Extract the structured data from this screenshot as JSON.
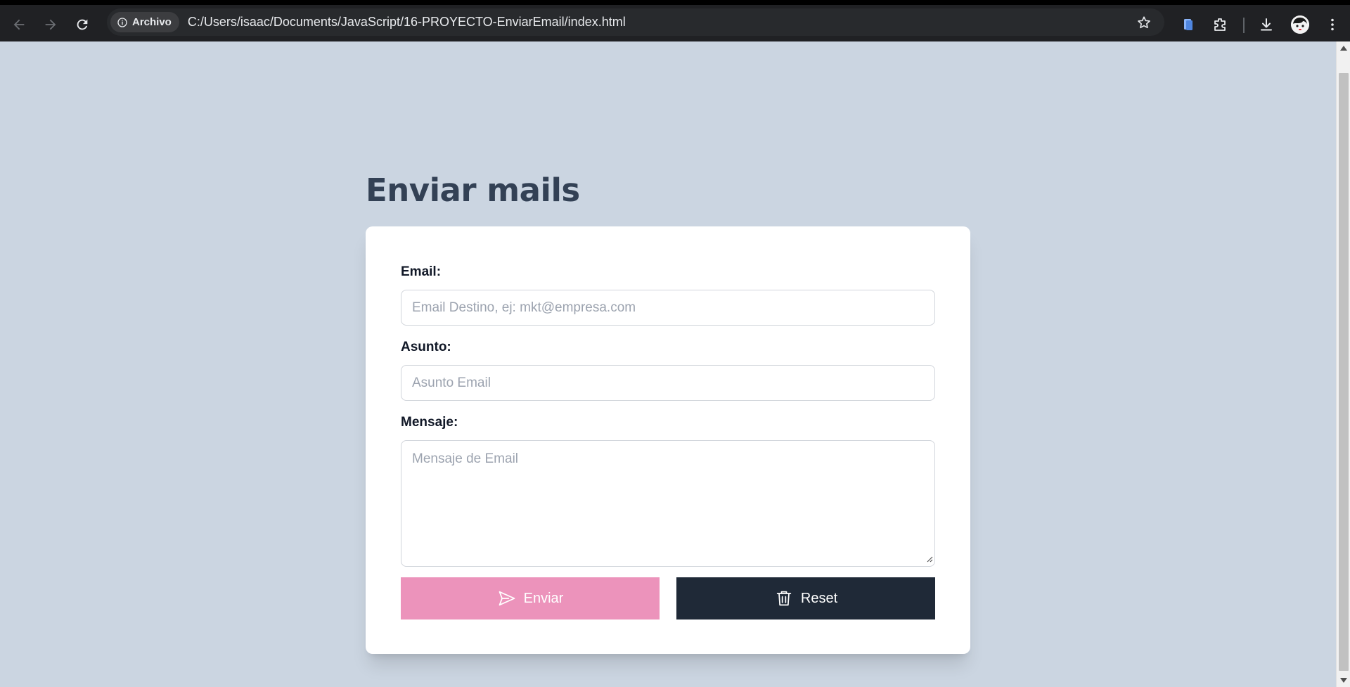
{
  "browser": {
    "chip_label": "Archivo",
    "url": "C:/Users/isaac/Documents/JavaScript/16-PROYECTO-EnviarEmail/index.html"
  },
  "page": {
    "title": "Enviar mails"
  },
  "form": {
    "email": {
      "label": "Email:",
      "placeholder": "Email Destino, ej: mkt@empresa.com",
      "value": ""
    },
    "asunto": {
      "label": "Asunto:",
      "placeholder": "Asunto Email",
      "value": ""
    },
    "mensaje": {
      "label": "Mensaje:",
      "placeholder": "Mensaje de Email",
      "value": ""
    },
    "send_label": "Enviar",
    "reset_label": "Reset"
  },
  "colors": {
    "page_bg": "#cbd5e1",
    "send_button": "#ec93bb",
    "reset_button": "#1f2937",
    "title": "#334155"
  },
  "icons": {
    "back": "arrow-left-icon",
    "forward": "arrow-right-icon",
    "reload": "reload-icon",
    "info": "info-icon",
    "bookmark": "star-icon",
    "reading_mode": "document-icon",
    "extensions": "puzzle-icon",
    "downloads": "download-icon",
    "profile": "avatar",
    "menu": "kebab-menu-icon",
    "send": "paper-plane-icon",
    "reset": "trash-icon"
  }
}
